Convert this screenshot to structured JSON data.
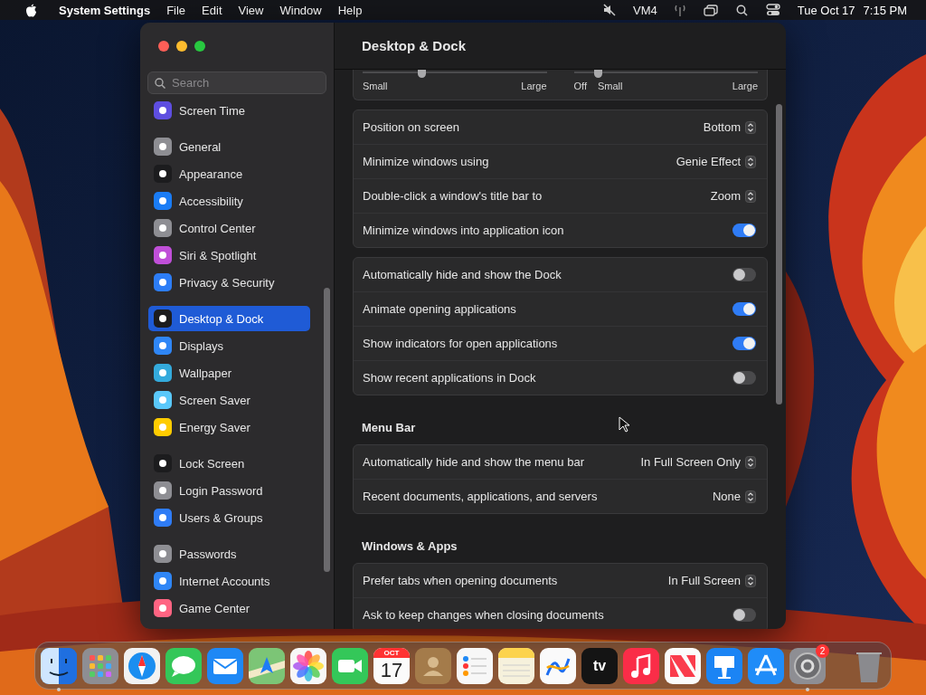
{
  "menu_bar": {
    "app_name": "System Settings",
    "menus": [
      "File",
      "Edit",
      "View",
      "Window",
      "Help"
    ],
    "status_text": "VM4",
    "date": "Tue Oct 17",
    "time": "7:15 PM"
  },
  "window": {
    "title": "Desktop & Dock",
    "search": {
      "placeholder": "Search"
    },
    "sidebar": {
      "groups": [
        {
          "items": [
            {
              "label": "Screen Time",
              "color": "#5e4ee0",
              "selected": false
            }
          ]
        },
        {
          "items": [
            {
              "label": "General",
              "color": "#8e8e93",
              "selected": false
            },
            {
              "label": "Appearance",
              "color": "#1c1c1e",
              "selected": false
            },
            {
              "label": "Accessibility",
              "color": "#1a7cf5",
              "selected": false
            },
            {
              "label": "Control Center",
              "color": "#8e8e93",
              "selected": false
            },
            {
              "label": "Siri & Spotlight",
              "color": "#c04fd8",
              "selected": false
            },
            {
              "label": "Privacy & Security",
              "color": "#2d7df6",
              "selected": false
            }
          ]
        },
        {
          "items": [
            {
              "label": "Desktop & Dock",
              "color": "#1c1c1e",
              "selected": true
            },
            {
              "label": "Displays",
              "color": "#2f86f6",
              "selected": false
            },
            {
              "label": "Wallpaper",
              "color": "#34aadc",
              "selected": false
            },
            {
              "label": "Screen Saver",
              "color": "#5ac8fa",
              "selected": false
            },
            {
              "label": "Energy Saver",
              "color": "#ffcc00",
              "selected": false
            }
          ]
        },
        {
          "items": [
            {
              "label": "Lock Screen",
              "color": "#1c1c1e",
              "selected": false
            },
            {
              "label": "Login Password",
              "color": "#8e8e93",
              "selected": false
            },
            {
              "label": "Users & Groups",
              "color": "#2f7cf6",
              "selected": false
            }
          ]
        },
        {
          "items": [
            {
              "label": "Passwords",
              "color": "#8e8e93",
              "selected": false
            },
            {
              "label": "Internet Accounts",
              "color": "#2f86f6",
              "selected": false
            },
            {
              "label": "Game Center",
              "color": "#ff6482",
              "selected": false
            }
          ]
        }
      ]
    },
    "sliders": [
      {
        "left_labels": [
          "Small"
        ],
        "right_label": "Large",
        "level": 0.32
      },
      {
        "left_labels": [
          "Off",
          "Small"
        ],
        "right_label": "Large",
        "level": 0.13
      }
    ],
    "sections": [
      {
        "rows": [
          {
            "kind": "popup",
            "label": "Position on screen",
            "value": "Bottom"
          },
          {
            "kind": "popup",
            "label": "Minimize windows using",
            "value": "Genie Effect"
          },
          {
            "kind": "popup",
            "label": "Double-click a window's title bar to",
            "value": "Zoom"
          },
          {
            "kind": "toggle",
            "label": "Minimize windows into application icon",
            "on": true
          }
        ]
      },
      {
        "rows": [
          {
            "kind": "toggle",
            "label": "Automatically hide and show the Dock",
            "on": false
          },
          {
            "kind": "toggle",
            "label": "Animate opening applications",
            "on": true
          },
          {
            "kind": "toggle",
            "label": "Show indicators for open applications",
            "on": true
          },
          {
            "kind": "toggle",
            "label": "Show recent applications in Dock",
            "on": false
          }
        ]
      },
      {
        "heading": "Menu Bar",
        "rows": [
          {
            "kind": "popup",
            "label": "Automatically hide and show the menu bar",
            "value": "In Full Screen Only"
          },
          {
            "kind": "popup",
            "label": "Recent documents, applications, and servers",
            "value": "None"
          }
        ]
      },
      {
        "heading": "Windows & Apps",
        "rows": [
          {
            "kind": "popup",
            "label": "Prefer tabs when opening documents",
            "value": "In Full Screen"
          },
          {
            "kind": "toggle",
            "label": "Ask to keep changes when closing documents",
            "on": false
          }
        ]
      }
    ]
  },
  "dock": {
    "items": [
      {
        "kind": "finder",
        "color": "#1f6fe0",
        "running": true
      },
      {
        "kind": "launchpad",
        "color": "#8e8e93",
        "running": false
      },
      {
        "kind": "safari",
        "color": "#f2f2f2",
        "running": false
      },
      {
        "kind": "messages",
        "color": "#34c759",
        "running": false
      },
      {
        "kind": "mail",
        "color": "#1e88f5",
        "running": false
      },
      {
        "kind": "maps",
        "color": "#7cc576",
        "running": false
      },
      {
        "kind": "photos",
        "color": "#f7f7f7",
        "running": false
      },
      {
        "kind": "facetime",
        "color": "#34c759",
        "running": false
      },
      {
        "kind": "calendar",
        "color": "#fbfbfb",
        "running": false,
        "month": "OCT",
        "day": "17"
      },
      {
        "kind": "contacts",
        "color": "#a47b4a",
        "running": false
      },
      {
        "kind": "reminders",
        "color": "#f7f7f7",
        "running": false
      },
      {
        "kind": "notes",
        "color": "#f6f1dc",
        "running": false
      },
      {
        "kind": "freeform",
        "color": "#fafafa",
        "running": false
      },
      {
        "kind": "tv",
        "color": "#141414",
        "running": false,
        "label": "tv"
      },
      {
        "kind": "music",
        "color": "#fa2d48",
        "running": false
      },
      {
        "kind": "news",
        "color": "#fbfbfb",
        "running": false
      },
      {
        "kind": "keynote",
        "color": "#1b84f4",
        "running": false
      },
      {
        "kind": "appstore",
        "color": "#1f8cf8",
        "running": false
      },
      {
        "kind": "settings",
        "color": "#8e8e93",
        "running": true,
        "badge": "2"
      },
      {
        "kind": "trash",
        "color": "#8a8a8e",
        "running": false
      }
    ]
  }
}
